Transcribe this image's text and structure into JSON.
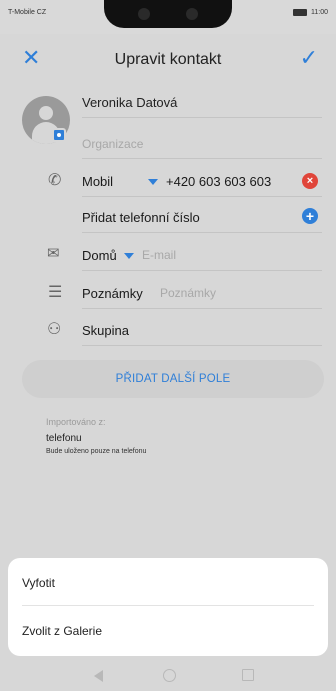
{
  "status_bar": {
    "carrier": "T-Mobile CZ",
    "time": "11:00"
  },
  "header": {
    "title": "Upravit kontakt"
  },
  "contact": {
    "name": "Veronika Datová",
    "organization_placeholder": "Organizace"
  },
  "phone": {
    "type": "Mobil",
    "number": "+420 603 603 603",
    "add_label": "Přidat telefonní číslo"
  },
  "email": {
    "type": "Domů",
    "placeholder": "E-mail"
  },
  "notes": {
    "label": "Poznámky",
    "placeholder": "Poznámky"
  },
  "group": {
    "label": "Skupina"
  },
  "add_field_button": "PŘIDAT DALŠÍ POLE",
  "import": {
    "label": "Importováno z:",
    "value": "telefonu",
    "note": "Bude uloženo pouze na telefonu"
  },
  "sheet": {
    "options": [
      "Vyfotit",
      "Zvolit z Galerie"
    ]
  },
  "colors": {
    "accent": "#2f7fd8",
    "danger": "#e0453a"
  }
}
